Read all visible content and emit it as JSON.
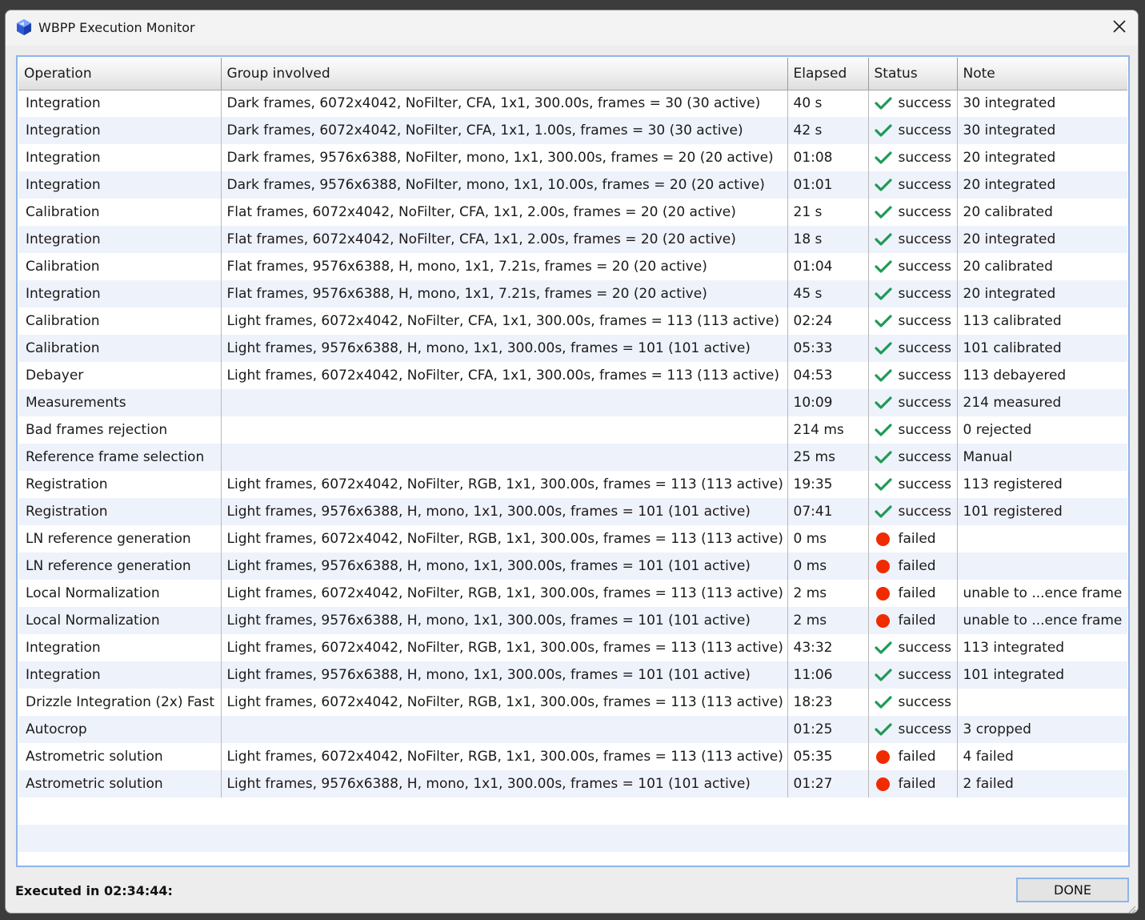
{
  "window": {
    "title": "WBPP Execution Monitor"
  },
  "table": {
    "columns": [
      "Operation",
      "Group involved",
      "Elapsed",
      "Status",
      "Note"
    ],
    "rows": [
      {
        "operation": "Integration",
        "group": "Dark frames, 6072x4042, NoFilter, CFA, 1x1, 300.00s, frames = 30 (30 active)",
        "elapsed": "40 s",
        "status": "success",
        "note": "30 integrated"
      },
      {
        "operation": "Integration",
        "group": "Dark frames, 6072x4042, NoFilter, CFA, 1x1, 1.00s, frames = 30 (30 active)",
        "elapsed": "42 s",
        "status": "success",
        "note": "30 integrated"
      },
      {
        "operation": "Integration",
        "group": "Dark frames, 9576x6388, NoFilter, mono, 1x1, 300.00s, frames = 20 (20 active)",
        "elapsed": "01:08",
        "status": "success",
        "note": "20 integrated"
      },
      {
        "operation": "Integration",
        "group": "Dark frames, 9576x6388, NoFilter, mono, 1x1, 10.00s, frames = 20 (20 active)",
        "elapsed": "01:01",
        "status": "success",
        "note": "20 integrated"
      },
      {
        "operation": "Calibration",
        "group": "Flat frames, 6072x4042, NoFilter, CFA, 1x1, 2.00s, frames = 20 (20 active)",
        "elapsed": "21 s",
        "status": "success",
        "note": "20 calibrated"
      },
      {
        "operation": "Integration",
        "group": "Flat frames, 6072x4042, NoFilter, CFA, 1x1, 2.00s, frames = 20 (20 active)",
        "elapsed": "18 s",
        "status": "success",
        "note": "20 integrated"
      },
      {
        "operation": "Calibration",
        "group": "Flat frames, 9576x6388, H, mono, 1x1, 7.21s, frames = 20 (20 active)",
        "elapsed": "01:04",
        "status": "success",
        "note": "20 calibrated"
      },
      {
        "operation": "Integration",
        "group": "Flat frames, 9576x6388, H, mono, 1x1, 7.21s, frames = 20 (20 active)",
        "elapsed": "45 s",
        "status": "success",
        "note": "20 integrated"
      },
      {
        "operation": "Calibration",
        "group": "Light frames, 6072x4042, NoFilter, CFA, 1x1, 300.00s, frames = 113 (113 active)",
        "elapsed": "02:24",
        "status": "success",
        "note": "113 calibrated"
      },
      {
        "operation": "Calibration",
        "group": "Light frames, 9576x6388, H, mono, 1x1, 300.00s, frames = 101 (101 active)",
        "elapsed": "05:33",
        "status": "success",
        "note": "101 calibrated"
      },
      {
        "operation": "Debayer",
        "group": "Light frames, 6072x4042, NoFilter, CFA, 1x1, 300.00s, frames = 113 (113 active)",
        "elapsed": "04:53",
        "status": "success",
        "note": "113 debayered"
      },
      {
        "operation": "Measurements",
        "group": "",
        "elapsed": "10:09",
        "status": "success",
        "note": "214 measured"
      },
      {
        "operation": "Bad frames rejection",
        "group": "",
        "elapsed": "214 ms",
        "status": "success",
        "note": "0 rejected"
      },
      {
        "operation": "Reference frame selection",
        "group": "",
        "elapsed": "25 ms",
        "status": "success",
        "note": "Manual"
      },
      {
        "operation": "Registration",
        "group": "Light frames, 6072x4042, NoFilter, RGB, 1x1, 300.00s, frames = 113 (113 active)",
        "elapsed": "19:35",
        "status": "success",
        "note": "113 registered"
      },
      {
        "operation": "Registration",
        "group": "Light frames, 9576x6388, H, mono, 1x1, 300.00s, frames = 101 (101 active)",
        "elapsed": "07:41",
        "status": "success",
        "note": "101 registered"
      },
      {
        "operation": "LN reference generation",
        "group": "Light frames, 6072x4042, NoFilter, RGB, 1x1, 300.00s, frames = 113 (113 active)",
        "elapsed": "0 ms",
        "status": "failed",
        "note": ""
      },
      {
        "operation": "LN reference generation",
        "group": "Light frames, 9576x6388, H, mono, 1x1, 300.00s, frames = 101 (101 active)",
        "elapsed": "0 ms",
        "status": "failed",
        "note": ""
      },
      {
        "operation": "Local Normalization",
        "group": "Light frames, 6072x4042, NoFilter, RGB, 1x1, 300.00s, frames = 113 (113 active)",
        "elapsed": "2 ms",
        "status": "failed",
        "note": "unable to ...ence frame"
      },
      {
        "operation": "Local Normalization",
        "group": "Light frames, 9576x6388, H, mono, 1x1, 300.00s, frames = 101 (101 active)",
        "elapsed": "2 ms",
        "status": "failed",
        "note": "unable to ...ence frame"
      },
      {
        "operation": "Integration",
        "group": "Light frames, 6072x4042, NoFilter, RGB, 1x1, 300.00s, frames = 113 (113 active)",
        "elapsed": "43:32",
        "status": "success",
        "note": "113 integrated"
      },
      {
        "operation": "Integration",
        "group": "Light frames, 9576x6388, H, mono, 1x1, 300.00s, frames = 101 (101 active)",
        "elapsed": "11:06",
        "status": "success",
        "note": "101 integrated"
      },
      {
        "operation": "Drizzle Integration (2x) Fast",
        "group": "Light frames, 6072x4042, NoFilter, RGB, 1x1, 300.00s, frames = 113 (113 active)",
        "elapsed": "18:23",
        "status": "success",
        "note": ""
      },
      {
        "operation": "Autocrop",
        "group": "",
        "elapsed": "01:25",
        "status": "success",
        "note": "3 cropped"
      },
      {
        "operation": "Astrometric solution",
        "group": "Light frames, 6072x4042, NoFilter, RGB, 1x1, 300.00s, frames = 113 (113 active)",
        "elapsed": "05:35",
        "status": "failed",
        "note": "4 failed"
      },
      {
        "operation": "Astrometric solution",
        "group": "Light frames, 9576x6388, H, mono, 1x1, 300.00s, frames = 101 (101 active)",
        "elapsed": "01:27",
        "status": "failed",
        "note": "2 failed"
      }
    ]
  },
  "footer": {
    "executed": "Executed in 02:34:44:",
    "done_label": "DONE"
  },
  "icons": {
    "success": "check-icon",
    "failed": "red-dot-icon",
    "close": "close-icon",
    "app": "wbpp-app-icon"
  },
  "colors": {
    "success": "#1f9a55",
    "failed": "#f02b00",
    "accent": "#8fb4e8",
    "alt_row": "#eef2fb"
  }
}
